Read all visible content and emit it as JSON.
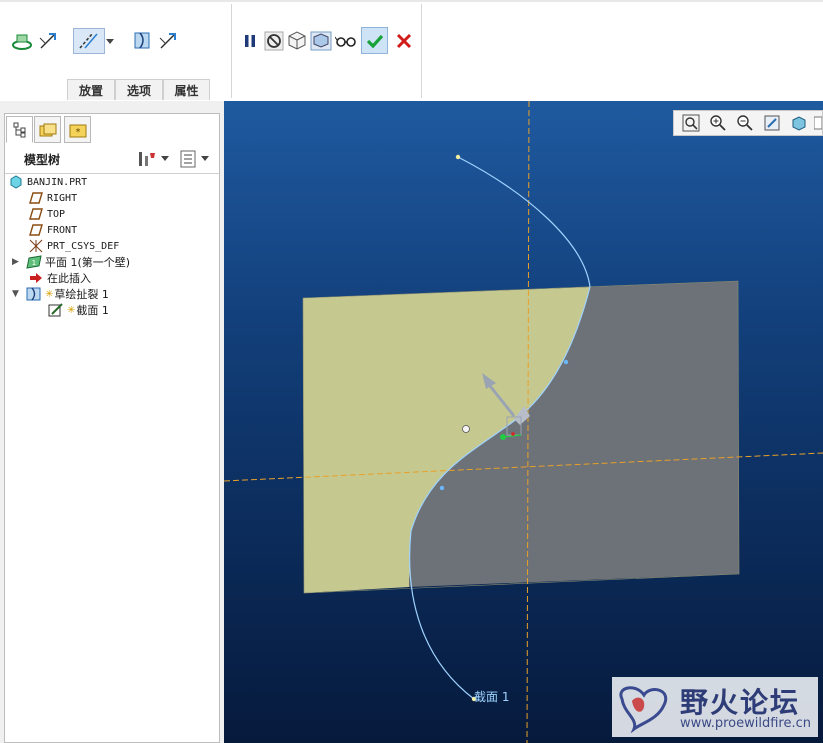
{
  "ribbon": {
    "tabs": [
      {
        "label": "放置"
      },
      {
        "label": "选项"
      },
      {
        "label": "属性"
      }
    ]
  },
  "model_tree": {
    "title": "模型树",
    "items": [
      {
        "label": "BANJIN.PRT",
        "icon": "part-icon"
      },
      {
        "label": "RIGHT",
        "icon": "datum-plane-icon"
      },
      {
        "label": "TOP",
        "icon": "datum-plane-icon"
      },
      {
        "label": "FRONT",
        "icon": "datum-plane-icon"
      },
      {
        "label": "PRT_CSYS_DEF",
        "icon": "coordinate-system-icon"
      },
      {
        "label": "平面 1(第一个壁)",
        "icon": "sheetmetal-wall-icon"
      },
      {
        "label": "在此插入",
        "icon": "insert-here-arrow-icon"
      },
      {
        "label": "草绘扯裂 1",
        "icon": "sketched-rip-icon"
      },
      {
        "label": "截面 1",
        "icon": "section-sketch-icon"
      }
    ]
  },
  "viewport": {
    "section_label": "截面 1"
  },
  "watermark": {
    "title": "野火论坛",
    "url": "www.proewildfire.cn"
  },
  "colors": {
    "viewport_top": "#1f5aa0",
    "viewport_bottom": "#061a3c",
    "plate_yellow": "#c6c98f",
    "plate_gray": "#6d7178",
    "curve": "#9fd3ff",
    "datum_axis": "#e8a028",
    "confirm": "#19a23a",
    "cancel": "#d21c1c"
  }
}
